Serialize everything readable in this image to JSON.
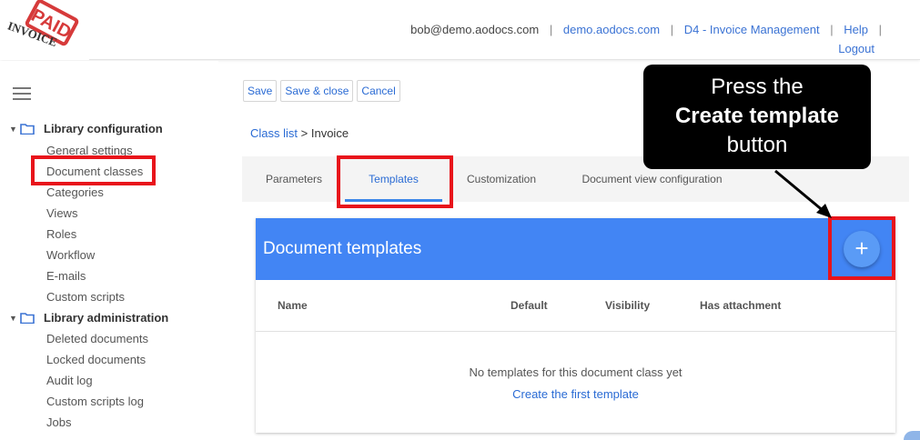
{
  "header": {
    "user_email": "bob@demo.aodocs.com",
    "domain_link": "demo.aodocs.com",
    "library_link": "D4 - Invoice Management",
    "help_link": "Help",
    "logout_link": "Logout",
    "logo_text": "PAID INVOICE"
  },
  "sidebar": {
    "sections": [
      {
        "label": "Library configuration",
        "items": [
          "General settings",
          "Document classes",
          "Categories",
          "Views",
          "Roles",
          "Workflow",
          "E-mails",
          "Custom scripts"
        ]
      },
      {
        "label": "Library administration",
        "items": [
          "Deleted documents",
          "Locked documents",
          "Audit log",
          "Custom scripts log",
          "Jobs"
        ]
      }
    ]
  },
  "toolbar": {
    "save_label": "Save",
    "save_close_label": "Save & close",
    "cancel_label": "Cancel"
  },
  "breadcrumb": {
    "link": "Class list",
    "separator": ">",
    "current": "Invoice"
  },
  "tabs": [
    "Parameters",
    "Templates",
    "Customization",
    "Document view configuration"
  ],
  "active_tab": "Templates",
  "templates_card": {
    "title": "Document templates",
    "add_button_glyph": "+",
    "columns": [
      "Name",
      "Default",
      "Visibility",
      "Has attachment"
    ],
    "empty_message": "No templates for this document class yet",
    "create_link": "Create the first template"
  },
  "annotation": {
    "line1": "Press the",
    "line2": "Create template",
    "line3": "button"
  },
  "colors": {
    "accent": "#4285f4",
    "link": "#2a6bd4",
    "highlight": "#e8141b"
  }
}
